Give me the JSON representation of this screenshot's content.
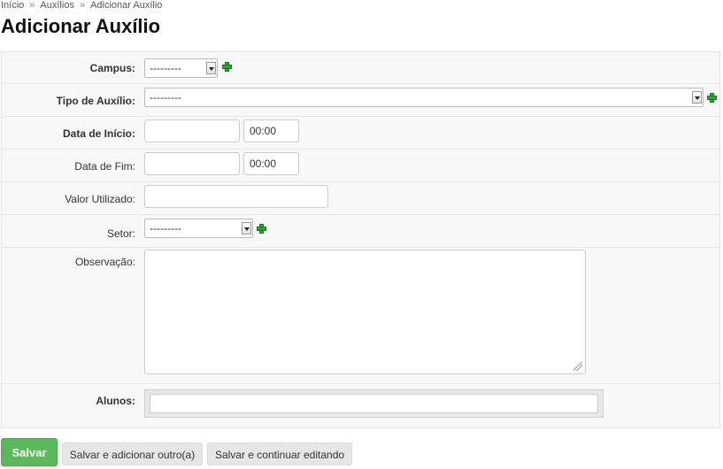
{
  "breadcrumb": {
    "items": [
      "Início",
      "Auxílios",
      "Adicionar Auxílio"
    ],
    "separator": "»"
  },
  "page": {
    "title": "Adicionar Auxílio"
  },
  "form": {
    "campus": {
      "label": "Campus:",
      "selected": "---------",
      "required": true
    },
    "tipo_auxilio": {
      "label": "Tipo de Auxílio:",
      "selected": "---------",
      "required": true
    },
    "data_inicio": {
      "label": "Data de Início:",
      "date_value": "",
      "time_value": "00:00",
      "required": true
    },
    "data_fim": {
      "label": "Data de Fim:",
      "date_value": "",
      "time_value": "00:00",
      "required": false
    },
    "valor_utilizado": {
      "label": "Valor Utilizado:",
      "value": "",
      "required": false
    },
    "setor": {
      "label": "Setor:",
      "selected": "---------",
      "required": false
    },
    "observacao": {
      "label": "Observação:",
      "value": "",
      "required": false
    },
    "alunos": {
      "label": "Alunos:",
      "value": "",
      "required": true
    }
  },
  "buttons": {
    "save": "Salvar",
    "save_add_another": "Salvar e adicionar outro(a)",
    "save_continue": "Salvar e continuar editando"
  },
  "colors": {
    "primary_button": "#5cb85c",
    "add_icon": "#2fa336",
    "form_background": "#f8f8f8"
  },
  "icons": {
    "add": "plus-icon",
    "dropdown": "chevron-down-icon",
    "resize": "resize-handle-icon"
  }
}
